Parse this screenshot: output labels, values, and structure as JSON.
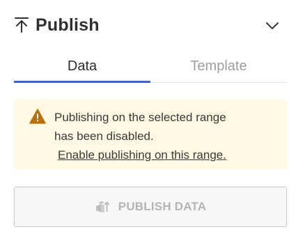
{
  "header": {
    "icon": "publish-icon",
    "title": "Publish",
    "collapse_icon": "chevron-down-icon"
  },
  "tabs": [
    {
      "label": "Data",
      "active": true
    },
    {
      "label": "Template",
      "active": false
    }
  ],
  "alert": {
    "icon": "warning-icon",
    "line1": "Publishing on the selected range",
    "line2": "has been disabled.",
    "link": "Enable publishing on this range."
  },
  "publish_button": {
    "label": "PUBLISH DATA",
    "icon": "publish-data-icon",
    "disabled": true
  },
  "colors": {
    "accent": "#3e63c6",
    "warning": "#b9710f",
    "alert_bg": "#fff8e2"
  }
}
